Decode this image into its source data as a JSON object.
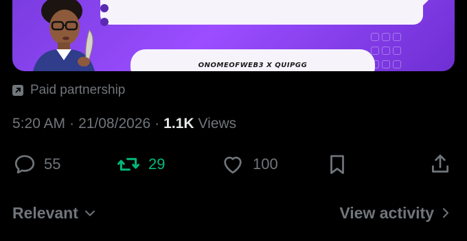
{
  "media": {
    "credit_text": "ONOMEOFWEB3 X QUIPGG",
    "background_color": "#8a44f0"
  },
  "post_meta": {
    "paid_partnership_label": "Paid partnership",
    "paid_icon": "partnership-arrow-icon",
    "time": "5:20 AM",
    "separator": "·",
    "date": "21/08/2026",
    "views_count": "1.1K",
    "views_label": "Views"
  },
  "actions": {
    "replies": {
      "icon": "reply-icon",
      "count": "55"
    },
    "reposts": {
      "icon": "repost-icon",
      "count": "29",
      "active": true,
      "color": "#00ba7c"
    },
    "likes": {
      "icon": "heart-icon",
      "count": "100"
    },
    "bookmark": {
      "icon": "bookmark-icon"
    },
    "share": {
      "icon": "share-icon"
    }
  },
  "replies_sort": {
    "label": "Relevant",
    "icon": "chevron-down-icon"
  },
  "view_activity": {
    "label": "View activity",
    "icon": "chevron-right-icon"
  },
  "colors": {
    "background": "#000000",
    "secondary_text": "#71767b",
    "primary_text": "#e7e9ea",
    "repost_green": "#00ba7c"
  }
}
